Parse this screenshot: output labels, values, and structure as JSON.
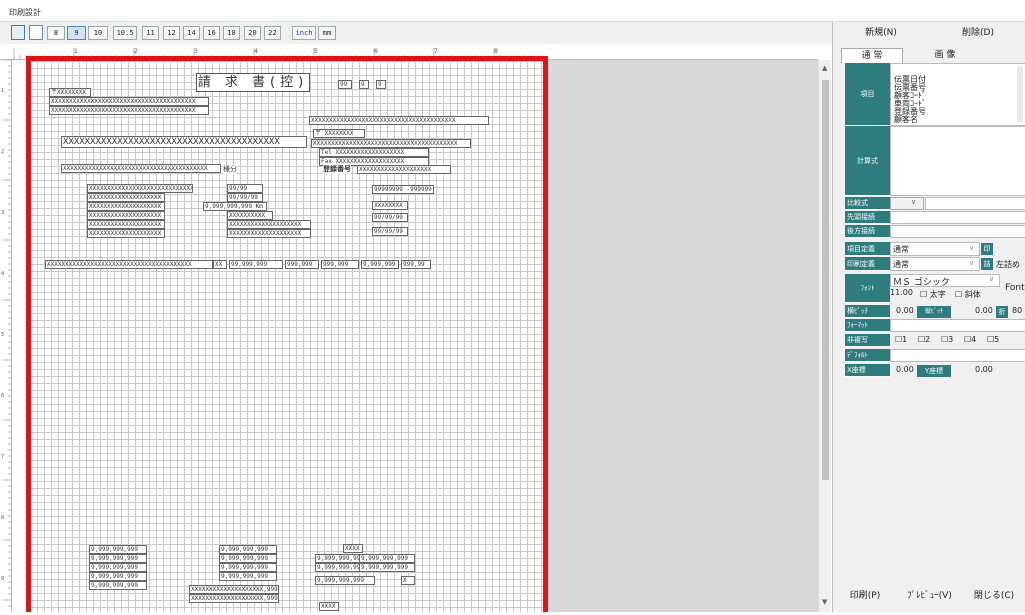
{
  "window": {
    "title": "印刷設計"
  },
  "toolbar": {
    "sizes": [
      "8",
      "9",
      "10",
      "10.5",
      "11",
      "12",
      "14",
      "16",
      "18",
      "20",
      "22"
    ],
    "selected_size": "9",
    "unit_inch": "inch",
    "unit_mm": "mm"
  },
  "ruler": {
    "h_labels": [
      "1",
      "2",
      "3",
      "4",
      "5",
      "6",
      "7",
      "8"
    ],
    "v_labels": [
      "1",
      "2",
      "3",
      "4",
      "5",
      "6",
      "7",
      "8",
      "9",
      "10"
    ]
  },
  "canvas": {
    "title": "請 求 書(控)",
    "date_fields": [
      "99",
      "9",
      "9"
    ],
    "postal": "〒XXXXXXXX",
    "addr1": "XXXXXXXXXXXXXXXXXXXXXXXXXXXXXXXXXXXXXXXX",
    "addr2": "XXXXXXXXXXXXXXXXXXXXXXXXXXXXXXXXXXXXXXXX",
    "company_big": "XXXXXXXXXXXXXXXXXXXXXXXXXXXXXXXXXXXXXXXX",
    "customer_big": "XXXXXXXXXXXXXXXXXXXXXXXXXXXXXXXXXXXXXXXX",
    "right_postal": "〒 XXXXXXXX",
    "right_addr": "XXXXXXXXXXXXXXXXXXXXXXXXXXXXXXXXXXXXXXXX",
    "tel": "Tel XXXXXXXXXXXXXXXXXXX",
    "fax": "Fax XXXXXXXXXXXXXXXXXXX",
    "honorific_field": "XXXXXXXXXXXXXXXXXXXXXXXXXXXXXXXXXXXXXXXX",
    "honorific": "様分",
    "reg_label": "登録番号",
    "reg_value": "XXXXXXXXXXXXXXXXXXXX",
    "left_block": [
      "XXXXXXXXXXXXXXXXXXXXXXXXXXXXX",
      "XXXXXXXXXXXXXXXXXXXX",
      "XXXXXXXXXXXXXXXXXXXX",
      "XXXXXXXXXXXXXXXXXXXX",
      "XXXXXXXXXXXXXXXXXXXX",
      "XXXXXXXXXXXXXXXXXXXX"
    ],
    "mid_block": [
      "99/99",
      "99/99/99",
      "9,999,999,999 Km",
      "XXXXXXXXXX",
      "XXXXXXXXXXXXXXXXXXXX",
      "XXXXXXXXXXXXXXXXXXXX"
    ],
    "right_block": [
      "99999999 -999999",
      "XXXXXXXX",
      "99/99/99",
      "99/99/99"
    ],
    "line_item": {
      "desc": "XXXXXXXXXXXXXXXXXXXXXXXXXXXXXXXXXXXXXXXX",
      "unit": "XX",
      "amounts": [
        "99,999,999",
        "999,999",
        "999,999",
        "9,999,999",
        "999,99"
      ]
    },
    "totals_left": [
      "9,999,999,999",
      "9,999,999,999",
      "9,999,999,999",
      "9,999,999,999",
      "9,999,999,999"
    ],
    "totals_mid": [
      "9,999,999,999",
      "9,999,999,999",
      "9,999,999,999",
      "9,999,999,999"
    ],
    "totals_right_top": "XXXX",
    "totals_right": [
      "9,999,999,999",
      "9,999,999,999",
      "9,999,999,999",
      "9,999,999,999"
    ],
    "totals_right_last": "9,999,999,999",
    "x_mark": "X",
    "bottom_fields": [
      "XXXXXXXXXXXXXXXXXXXX,999",
      "XXXXXXXXXXXXXXXXXXXX,999"
    ],
    "bottom_mark": "XXXX"
  },
  "panel": {
    "new_button": "新規(N)",
    "delete_button": "削除(D)",
    "tabs": [
      "通 常",
      "画 像"
    ],
    "item_label": "項目",
    "items": [
      "伝票日付",
      "伝票番号",
      "顧客ｺｰﾄﾞ",
      "車両ｺｰﾄﾞ",
      "登録番号",
      "顧客名"
    ],
    "formula_label": "計算式",
    "compare_label": "比較式",
    "prev_conn_label": "先頭接続",
    "next_conn_label": "後方接続",
    "item_def_label": "項目定義",
    "item_def_value": "通常",
    "print_def_label": "印刷定義",
    "print_def_value": "通常",
    "print_mark": "印",
    "align_mark": "詰",
    "align_value": "左詰め",
    "font_label": "ﾌｫﾝﾄ",
    "font_value": "ＭＳ ゴシック",
    "font_button": "Font",
    "font_size": "11.00",
    "bold": "太字",
    "italic": "斜体",
    "pitch_label": "横ﾋﾟｯﾁ",
    "pitch_value": "0.00",
    "vpitch_label": "縦ﾋﾟｯﾁ",
    "vpitch_value": "0.00",
    "fold_label": "折",
    "fold_value": "80",
    "format_label": "ﾌｫｰﾏｯﾄ",
    "nonprint_label": "非複写",
    "nonprint_options": [
      "1",
      "2",
      "3",
      "4",
      "5"
    ],
    "default_label": "ﾃﾞﾌｫﾙﾄ",
    "x_label": "X座標",
    "x_value": "0.00",
    "y_label": "Y座標",
    "y_value": "0.00",
    "print_button": "印刷(P)",
    "preview_button": "ﾌﾟﾚﾋﾞｭｰ(V)",
    "close_button": "閉じる(C)"
  },
  "colors": {
    "teal": "#2f7c7f",
    "red_border": "#e01414"
  }
}
